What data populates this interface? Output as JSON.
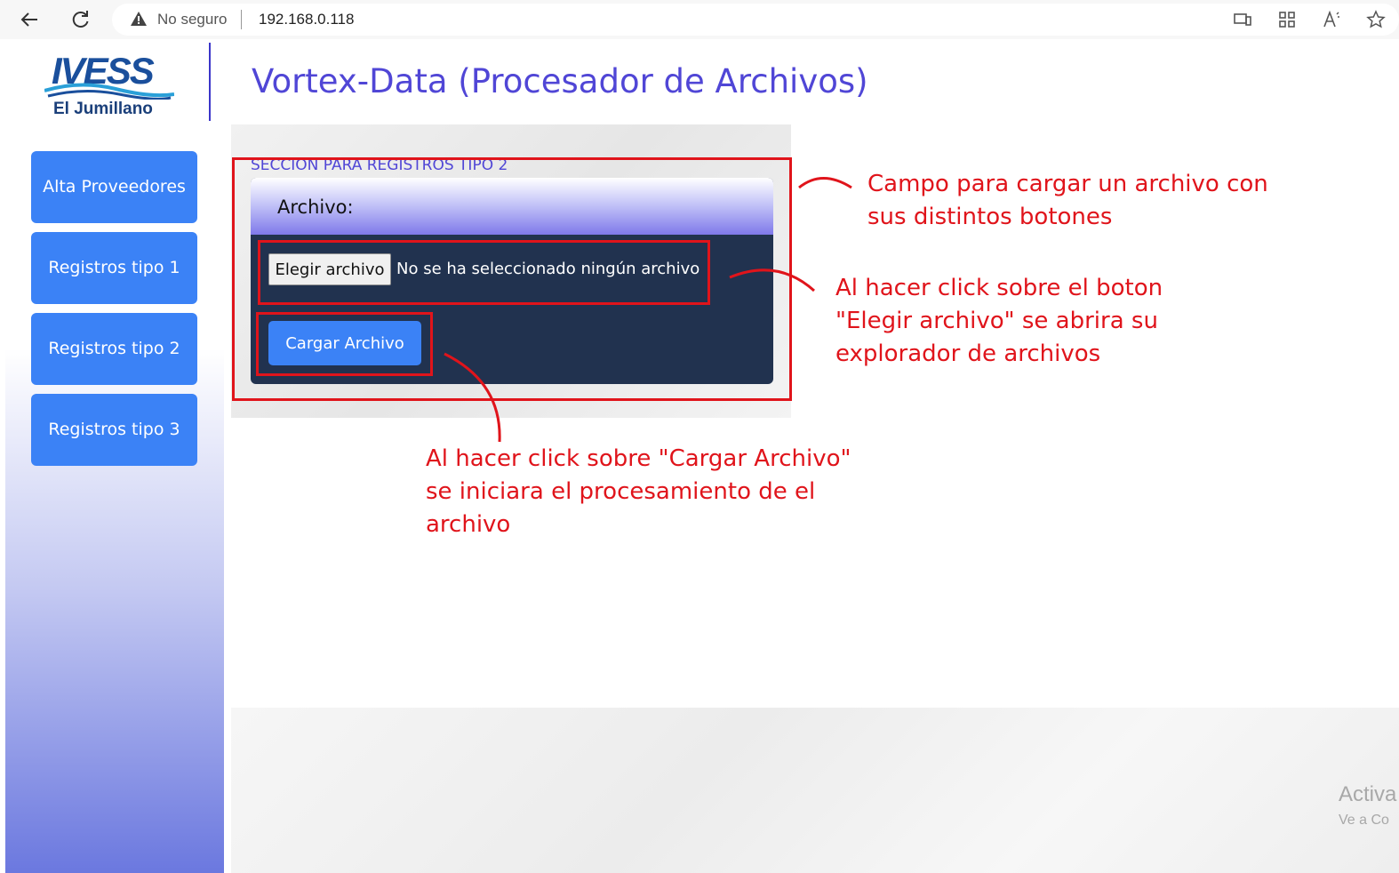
{
  "browser": {
    "back_icon": "back-arrow-icon",
    "reload_icon": "reload-icon",
    "security_label": "No seguro",
    "url": "192.168.0.118"
  },
  "header": {
    "logo_word": "IVESS",
    "logo_sub": "El Jumillano",
    "title": "Vortex-Data (Procesador de Archivos)"
  },
  "sidebar": {
    "items": [
      {
        "label": "Alta Proveedores"
      },
      {
        "label": "Registros tipo 1"
      },
      {
        "label": "Registros tipo 2"
      },
      {
        "label": "Registros tipo 3"
      }
    ]
  },
  "main": {
    "section_title": "SECCION PARA REGISTROS TIPO 2",
    "card_label": "Archivo:",
    "file_button": "Elegir archivo",
    "file_status": "No se ha seleccionado ningún archivo",
    "upload_button": "Cargar Archivo"
  },
  "annotations": {
    "a1_line1": "Campo para cargar un archivo con",
    "a1_line2": "sus distintos botones",
    "a2_line1": "Al hacer click sobre el boton",
    "a2_line2": "\"Elegir archivo\" se abrira su",
    "a2_line3": "explorador de archivos",
    "a3_line1": "Al hacer click sobre \"Cargar Archivo\"",
    "a3_line2": "se iniciara el procesamiento de el",
    "a3_line3": "archivo"
  },
  "watermark": {
    "line1": "Activa",
    "line2": "Ve a Co"
  },
  "colors": {
    "accent": "#3b82f6",
    "title": "#5046d6",
    "card_bg": "#21324f",
    "annotation": "#e0141b"
  }
}
